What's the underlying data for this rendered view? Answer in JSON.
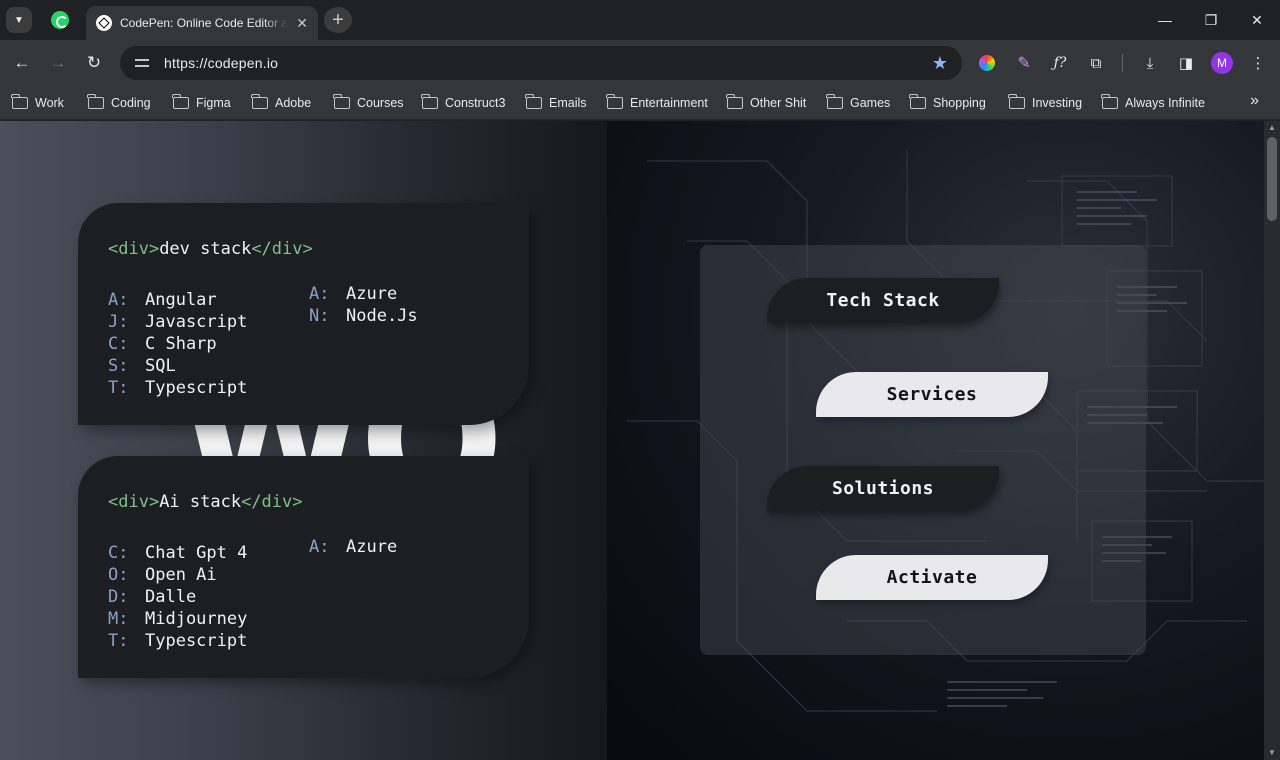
{
  "browser": {
    "tab": {
      "title": "CodePen: Online Code Editor and Front End Web Developer Community",
      "close": "✕"
    },
    "new_tab": "+",
    "window": {
      "minimize": "—",
      "restore": "❐",
      "close": "✕"
    },
    "url": "https://codepen.io",
    "avatar_initial": "M",
    "bookmarks": [
      "Work",
      "Coding",
      "Figma",
      "Adobe",
      "Courses",
      "Construct3",
      "Emails",
      "Entertainment",
      "Other Shit",
      "Games",
      "Shopping",
      "Investing",
      "Always Infinite"
    ],
    "bookmarks_more": "»"
  },
  "dev_stack": {
    "tag_open": "<div>",
    "title": "dev stack",
    "tag_close": "</div>",
    "col1": [
      {
        "key": "A:",
        "value": "Angular"
      },
      {
        "key": "J:",
        "value": "Javascript"
      },
      {
        "key": "C:",
        "value": "C Sharp"
      },
      {
        "key": "S:",
        "value": "SQL"
      },
      {
        "key": "T:",
        "value": "Typescript"
      }
    ],
    "col2": [
      {
        "key": "A:",
        "value": "Azure"
      },
      {
        "key": "N:",
        "value": "Node.Js"
      }
    ]
  },
  "ai_stack": {
    "tag_open": "<div>",
    "title": "Ai stack",
    "tag_close": "</div>",
    "col1": [
      {
        "key": "C:",
        "value": "Chat Gpt 4"
      },
      {
        "key": "O:",
        "value": "Open Ai"
      },
      {
        "key": "D:",
        "value": "Dalle"
      },
      {
        "key": "M:",
        "value": "Midjourney"
      },
      {
        "key": "T:",
        "value": "Typescript"
      }
    ],
    "col2": [
      {
        "key": "A:",
        "value": "Azure"
      }
    ]
  },
  "background_letters": "WO",
  "menu": {
    "tech_stack": "Tech Stack",
    "services": "Services",
    "solutions": "Solutions",
    "activate": "Activate"
  },
  "colors": {
    "tag_green": "#7fbf8a",
    "key_blue": "#8aa1c8",
    "card_bg": "#1d1e22",
    "button_light": "#e9e9ec"
  }
}
